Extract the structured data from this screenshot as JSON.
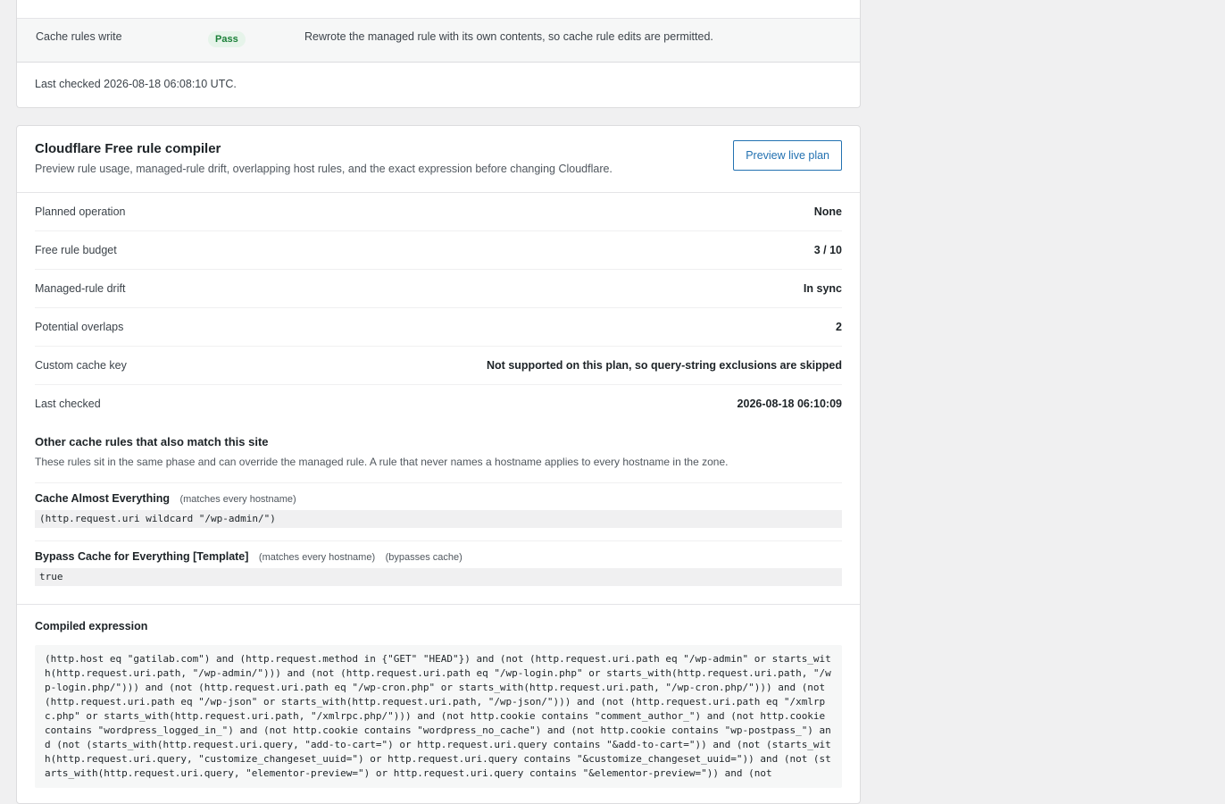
{
  "top_card": {
    "row_label": "Cache rules write",
    "status": "Pass",
    "message": "Rewrote the managed rule with its own contents, so cache rule edits are permitted.",
    "last_checked": "Last checked 2026-08-18 06:08:10 UTC."
  },
  "compiler": {
    "title": "Cloudflare Free rule compiler",
    "subtitle": "Preview rule usage, managed-rule drift, overlapping host rules, and the exact expression before changing Cloudflare.",
    "preview_button": "Preview live plan",
    "stats": [
      {
        "label": "Planned operation",
        "value": "None"
      },
      {
        "label": "Free rule budget",
        "value": "3 / 10"
      },
      {
        "label": "Managed-rule drift",
        "value": "In sync"
      },
      {
        "label": "Potential overlaps",
        "value": "2"
      },
      {
        "label": "Custom cache key",
        "value": "Not supported on this plan, so query-string exclusions are skipped"
      },
      {
        "label": "Last checked",
        "value": "2026-08-18 06:10:09"
      }
    ],
    "overlap": {
      "title": "Other cache rules that also match this site",
      "description": "These rules sit in the same phase and can override the managed rule. A rule that never names a hostname applies to every hostname in the zone.",
      "rules": [
        {
          "name": "Cache Almost Everything",
          "tags": [
            "(matches every hostname)"
          ],
          "expression": "(http.request.uri wildcard \"/wp-admin/\")"
        },
        {
          "name": "Bypass Cache for Everything [Template]",
          "tags": [
            "(matches every hostname)",
            "(bypasses cache)"
          ],
          "expression": "true"
        }
      ]
    },
    "compiled_title": "Compiled expression",
    "compiled_expression": "(http.host eq \"gatilab.com\") and (http.request.method in {\"GET\" \"HEAD\"}) and (not (http.request.uri.path eq \"/wp-admin\" or starts_with(http.request.uri.path, \"/wp-admin/\"))) and (not (http.request.uri.path eq \"/wp-login.php\" or starts_with(http.request.uri.path, \"/wp-login.php/\"))) and (not (http.request.uri.path eq \"/wp-cron.php\" or starts_with(http.request.uri.path, \"/wp-cron.php/\"))) and (not (http.request.uri.path eq \"/wp-json\" or starts_with(http.request.uri.path, \"/wp-json/\"))) and (not (http.request.uri.path eq \"/xmlrpc.php\" or starts_with(http.request.uri.path, \"/xmlrpc.php/\"))) and (not http.cookie contains \"comment_author_\") and (not http.cookie contains \"wordpress_logged_in_\") and (not http.cookie contains \"wordpress_no_cache\") and (not http.cookie contains \"wp-postpass_\") and (not (starts_with(http.request.uri.query, \"add-to-cart=\") or http.request.uri.query contains \"&add-to-cart=\")) and (not (starts_with(http.request.uri.query, \"customize_changeset_uuid=\") or http.request.uri.query contains \"&customize_changeset_uuid=\")) and (not (starts_with(http.request.uri.query, \"elementor-preview=\") or http.request.uri.query contains \"&elementor-preview=\")) and (not"
  }
}
